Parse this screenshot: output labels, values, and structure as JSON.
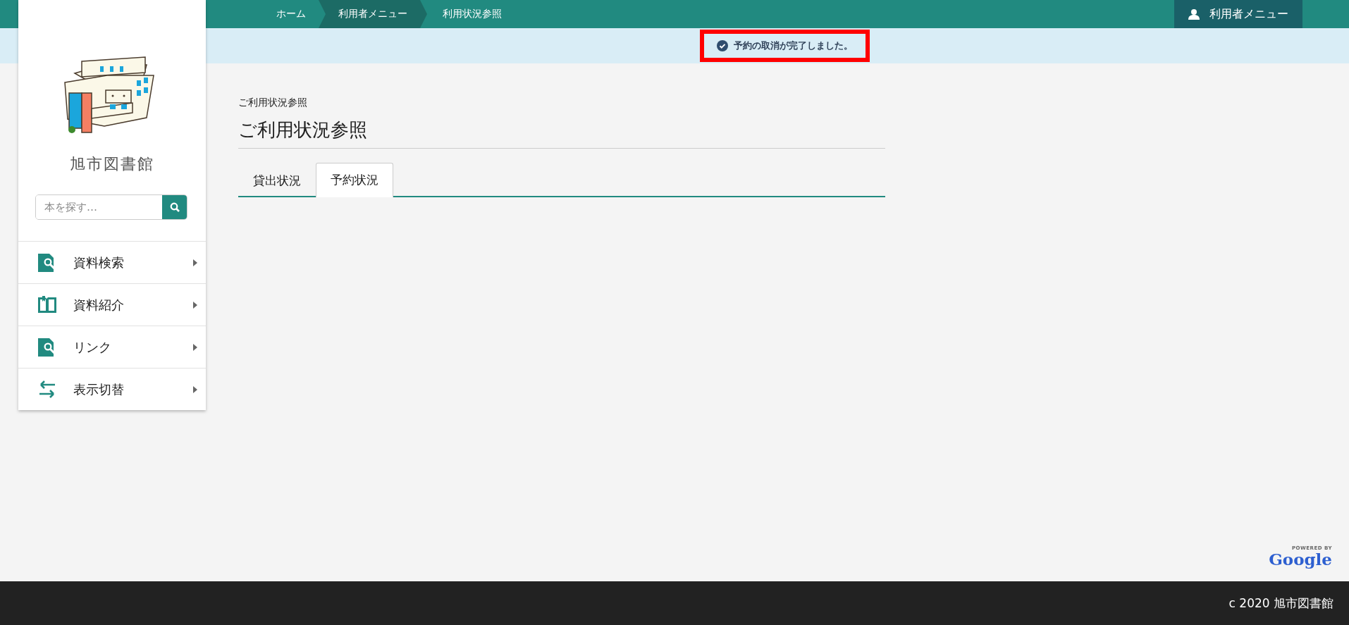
{
  "breadcrumb": [
    {
      "label": "ホーム",
      "active": false
    },
    {
      "label": "利用者メニュー",
      "active": true
    },
    {
      "label": "利用状況参照",
      "active": false
    }
  ],
  "user_menu": {
    "label": "利用者メニュー"
  },
  "alert": {
    "message": "予約の取消が完了しました。",
    "highlighted": true
  },
  "sidebar": {
    "library_name": "旭市図書館",
    "search": {
      "placeholder": "本を探す…"
    },
    "items": [
      {
        "label": "資料検索",
        "kind": "search"
      },
      {
        "label": "資料紹介",
        "kind": "book"
      },
      {
        "label": "リンク",
        "kind": "search"
      },
      {
        "label": "表示切替",
        "kind": "switch"
      }
    ]
  },
  "page": {
    "small_title": "ご利用状況参照",
    "title": "ご利用状況参照",
    "tabs": [
      {
        "label": "貸出状況",
        "selected": false
      },
      {
        "label": "予約状況",
        "selected": true
      }
    ]
  },
  "powered_by": {
    "caption": "POWERED BY",
    "brand": "Google"
  },
  "footer": {
    "copyright": "c 2020 旭市図書館"
  }
}
